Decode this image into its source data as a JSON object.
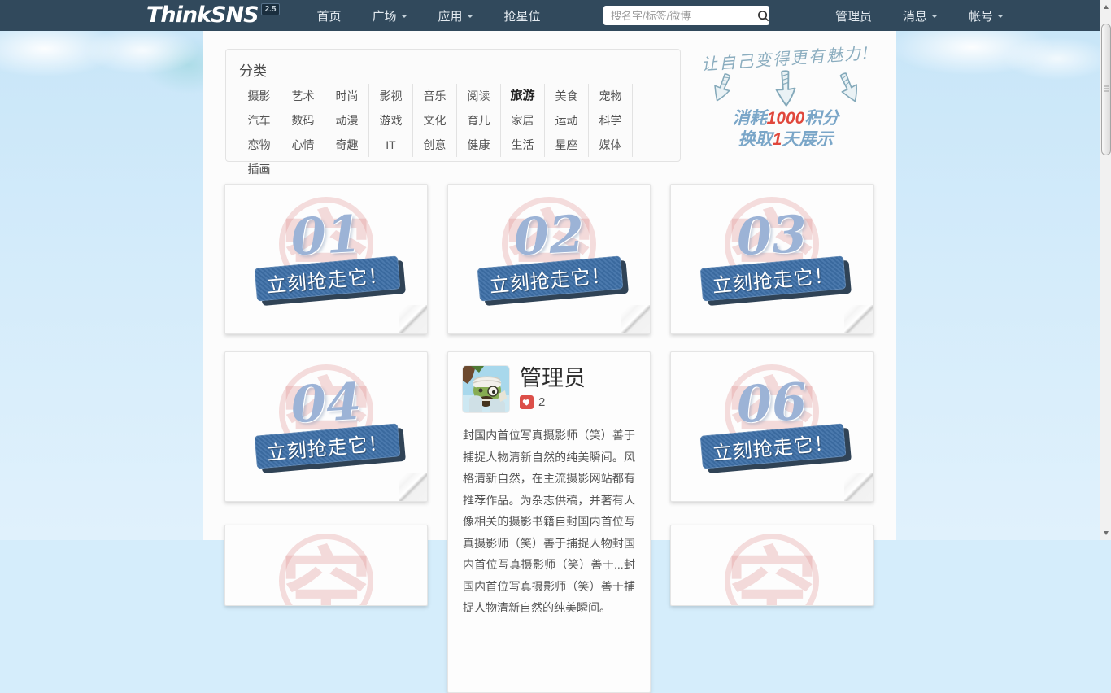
{
  "navbar": {
    "logo": "ThinkSNS",
    "logo_version": "2.5",
    "menu": [
      {
        "label": "首页",
        "caret": false
      },
      {
        "label": "广场",
        "caret": true
      },
      {
        "label": "应用",
        "caret": true
      },
      {
        "label": "抢星位",
        "caret": false
      }
    ],
    "search_placeholder": "搜名字/标签/微博",
    "right_menu": [
      {
        "label": "管理员",
        "caret": false
      },
      {
        "label": "消息",
        "caret": true
      },
      {
        "label": "帐号",
        "caret": true
      }
    ]
  },
  "categories": {
    "title": "分类",
    "items": [
      {
        "label": "摄影"
      },
      {
        "label": "艺术"
      },
      {
        "label": "时尚"
      },
      {
        "label": "影视"
      },
      {
        "label": "音乐"
      },
      {
        "label": "阅读"
      },
      {
        "label": "旅游",
        "active": true
      },
      {
        "label": "美食"
      },
      {
        "label": "宠物"
      },
      {
        "label": "汽车"
      },
      {
        "label": "数码"
      },
      {
        "label": "动漫"
      },
      {
        "label": "游戏"
      },
      {
        "label": "文化"
      },
      {
        "label": "育儿"
      },
      {
        "label": "家居"
      },
      {
        "label": "运动"
      },
      {
        "label": "科学"
      },
      {
        "label": "恋物"
      },
      {
        "label": "心情"
      },
      {
        "label": "奇趣"
      },
      {
        "label": "IT"
      },
      {
        "label": "创意"
      },
      {
        "label": "健康"
      },
      {
        "label": "生活"
      },
      {
        "label": "星座"
      },
      {
        "label": "媒体"
      },
      {
        "label": "插画"
      }
    ]
  },
  "promo": {
    "headline": "让自己变得更有魅力!",
    "line1_prefix": "消耗",
    "line1_value": "1000",
    "line1_suffix": "积分",
    "line2_prefix": "换取",
    "line2_value": "1",
    "line2_suffix": "天展示"
  },
  "cards": {
    "ribbon_label": "立刻抢走它！",
    "watermark_char": "空",
    "empty_numbers": [
      "01",
      "02",
      "03",
      "04",
      "06"
    ],
    "profile": {
      "name": "管理员",
      "likes": "2",
      "bio": "封国内首位写真摄影师（笑）善于捕捉人物清新自然的纯美瞬间。风格清新自然，在主流摄影网站都有推荐作品。为杂志供稿，并著有人像相关的摄影书籍自封国内首位写真摄影师（笑）善于捕捉人物封国内首位写真摄影师（笑）善于...封国内首位写真摄影师（笑）善于捕捉人物清新自然的纯美瞬间。"
    }
  },
  "colors": {
    "navbar_bg": "#31495c",
    "ribbon_blue": "#3d6fa7",
    "ribbon_shadow": "#1e3348",
    "number_blue": "#9cb3d6",
    "watermark_pink": "#dd8a8a",
    "promo_blue": "#7aa6c8",
    "promo_red": "#e0473c",
    "heart_red": "#dc4f49",
    "sky_bg": "#c7e5f8"
  }
}
